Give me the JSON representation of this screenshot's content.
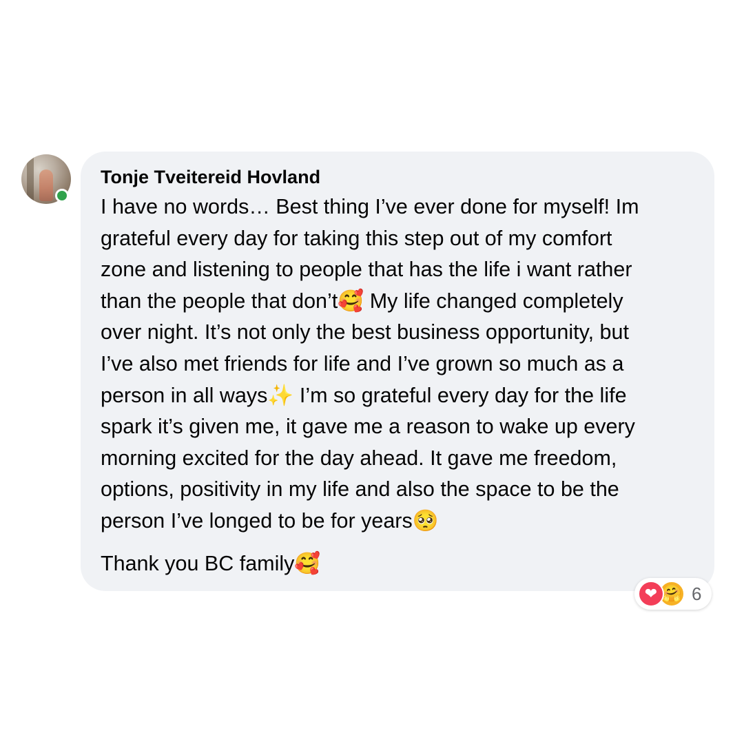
{
  "comment": {
    "author": "Tonje Tveitereid Hovland",
    "body": "I have no words… Best thing I’ve ever done for myself! Im\ngrateful every day for taking this step out of my comfort\nzone and listening to people that has the life i want rather\nthan the people that don’t🥰 My life changed completely\nover night. It’s not only the best business opportunity, but\nI’ve also met friends for life and I’ve grown so much as a\nperson in all ways✨ I’m so grateful every day for the life\nspark it’s given me, it gave me a reason to wake up every\nmorning excited for the day ahead. It gave me freedom,\noptions, positivity in my life and also the space to be the\nperson I’ve longed to be for years🥺",
    "closing": "Thank you BC family🥰",
    "online": true
  },
  "reactions": {
    "icons": [
      "love-reaction-icon",
      "care-reaction-icon"
    ],
    "love_glyph": "❤",
    "care_glyph": "🤗",
    "count": "6"
  },
  "colors": {
    "bubble": "#f0f2f5",
    "online": "#31a24c",
    "love": "#f33e58",
    "care": "#f7b125",
    "count_text": "#65676b"
  }
}
